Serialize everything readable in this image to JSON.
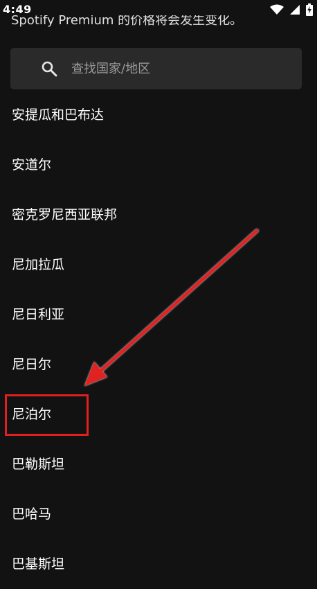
{
  "status_bar": {
    "time": "4:49",
    "icons": [
      "wifi-icon",
      "signal-icon",
      "battery-charging-icon"
    ]
  },
  "header": {
    "text": "Spotify Premium 的价格将会发生变化。"
  },
  "search": {
    "placeholder": "查找国家/地区",
    "value": ""
  },
  "countries": [
    "安提瓜和巴布达",
    "安道尔",
    "密克罗尼西亚联邦",
    "尼加拉瓜",
    "尼日利亚",
    "尼日尔",
    "尼泊尔",
    "巴勒斯坦",
    "巴哈马",
    "巴基斯坦"
  ],
  "annotation": {
    "highlighted_item": "尼泊尔",
    "color": "#e02020"
  },
  "colors": {
    "background": "#121212",
    "search_bg": "#2a2a2a",
    "text": "#ffffff",
    "placeholder": "#9a9a9a"
  }
}
